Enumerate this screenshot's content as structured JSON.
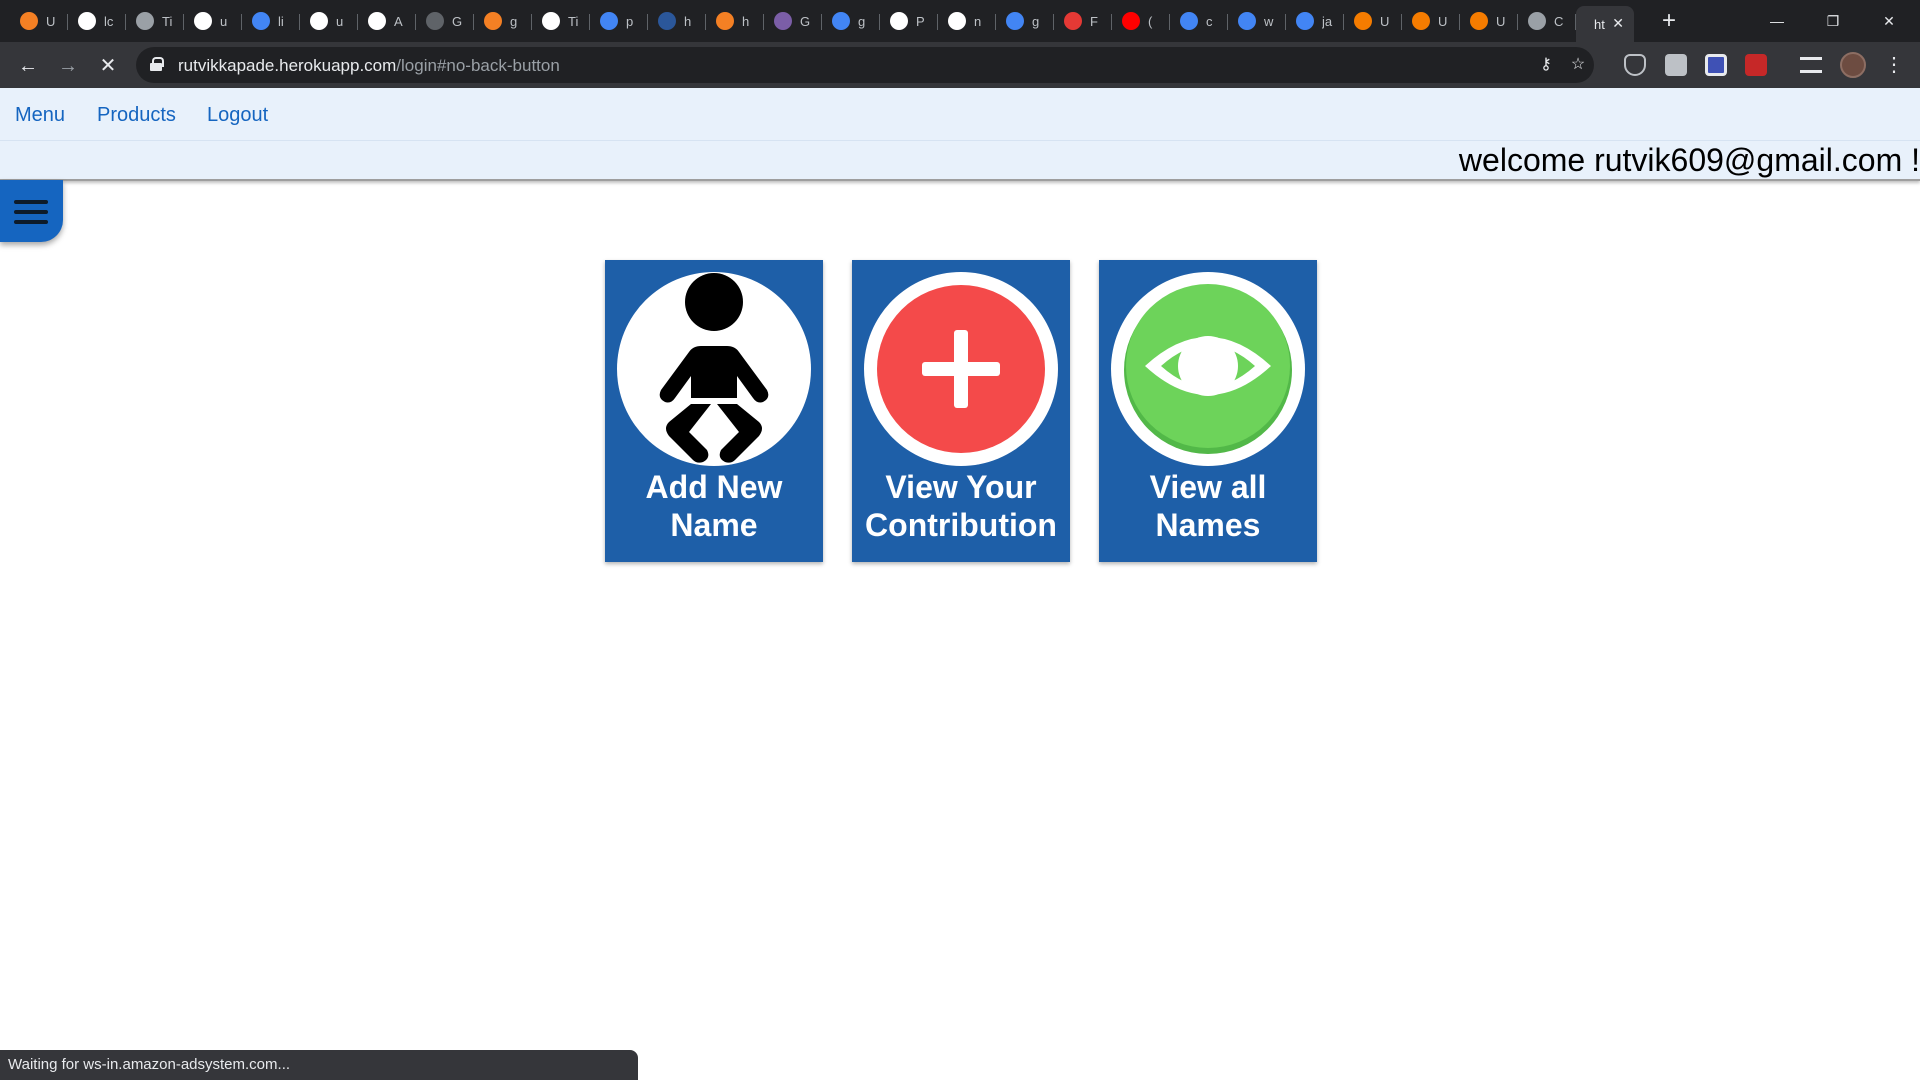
{
  "browser": {
    "tabs": [
      {
        "title": "U",
        "icon": "stackoverflow-icon",
        "color": "#f48024"
      },
      {
        "title": "lc",
        "icon": "globe-icon",
        "color": "#ffffff"
      },
      {
        "title": "Ti",
        "icon": "globe-icon",
        "color": "#9aa0a6"
      },
      {
        "title": "u",
        "icon": "globe-icon",
        "color": "#ffffff"
      },
      {
        "title": "li",
        "icon": "google-icon",
        "color": "#4285f4"
      },
      {
        "title": "u",
        "icon": "globe-icon",
        "color": "#ffffff"
      },
      {
        "title": "A",
        "icon": "github-icon",
        "color": "#ffffff"
      },
      {
        "title": "G",
        "icon": "github-icon",
        "color": "#5f6368"
      },
      {
        "title": "g",
        "icon": "stackoverflow-icon",
        "color": "#f48024"
      },
      {
        "title": "Ti",
        "icon": "globe-icon",
        "color": "#ffffff"
      },
      {
        "title": "p",
        "icon": "google-icon",
        "color": "#4285f4"
      },
      {
        "title": "h",
        "icon": "word-icon",
        "color": "#2b579a"
      },
      {
        "title": "h",
        "icon": "stackoverflow-icon",
        "color": "#f48024"
      },
      {
        "title": "G",
        "icon": "hackernoon-icon",
        "color": "#7b5ea7"
      },
      {
        "title": "g",
        "icon": "google-icon",
        "color": "#4285f4"
      },
      {
        "title": "P",
        "icon": "github-icon",
        "color": "#ffffff"
      },
      {
        "title": "n",
        "icon": "github-icon",
        "color": "#ffffff"
      },
      {
        "title": "g",
        "icon": "google-icon",
        "color": "#4285f4"
      },
      {
        "title": "F",
        "icon": "vivaldi-icon",
        "color": "#e53935"
      },
      {
        "title": "(",
        "icon": "youtube-icon",
        "color": "#ff0000"
      },
      {
        "title": "c",
        "icon": "google-icon",
        "color": "#4285f4"
      },
      {
        "title": "w",
        "icon": "google-icon",
        "color": "#4285f4"
      },
      {
        "title": "ja",
        "icon": "google-icon",
        "color": "#4285f4"
      },
      {
        "title": "U",
        "icon": "ubuntu-icon",
        "color": "#f57c00"
      },
      {
        "title": "U",
        "icon": "ubuntu-icon",
        "color": "#f57c00"
      },
      {
        "title": "U",
        "icon": "ubuntu-icon",
        "color": "#f57c00"
      },
      {
        "title": "C",
        "icon": "globe-icon",
        "color": "#9aa0a6"
      }
    ],
    "active_tab": {
      "title": "ht"
    },
    "url_host": "rutvikkapade.herokuapp.com",
    "url_path": "/login#no-back-button",
    "status_text": "Waiting for ws-in.amazon-adsystem.com..."
  },
  "nav": {
    "menu": "Menu",
    "products": "Products",
    "logout": "Logout",
    "welcome": "welcome  rutvik609@gmail.com !"
  },
  "cards": [
    {
      "line1": "Add New",
      "line2": "Name",
      "icon": "baby-icon",
      "color": "#000000"
    },
    {
      "line1": "View Your",
      "line2": "Contribution",
      "icon": "plus-icon",
      "color": "#f44336"
    },
    {
      "line1": "View all",
      "line2": "Names",
      "icon": "eye-icon",
      "color": "#6ccf5a"
    }
  ],
  "colors": {
    "card_bg": "#1e5fa8",
    "nav_bg": "#e8f1fb",
    "link": "#1565c0"
  }
}
